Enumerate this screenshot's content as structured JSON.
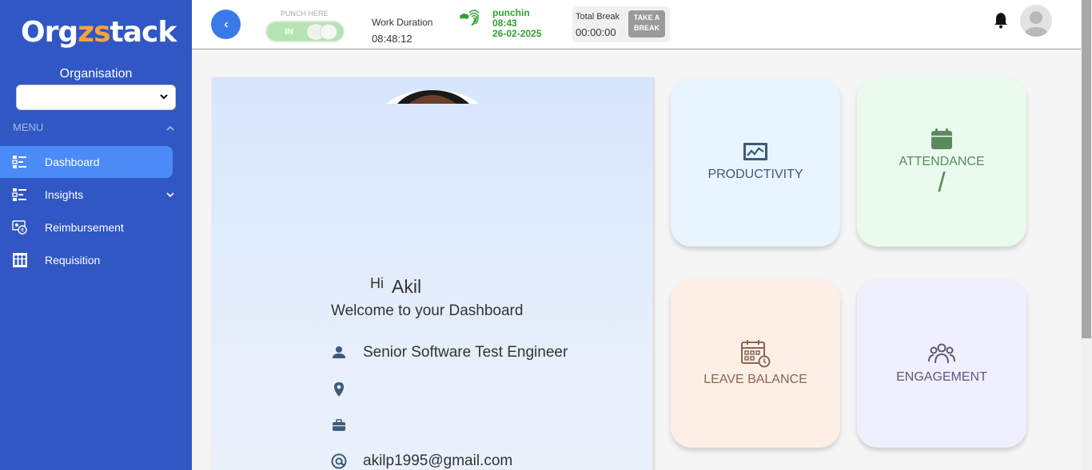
{
  "sidebar": {
    "logo_prefix": "Org",
    "logo_accent": "zs",
    "logo_suffix": "tack",
    "org_label": "Organisation",
    "org_selected": "",
    "menu_header": "MENU",
    "items": [
      {
        "label": "Dashboard",
        "icon": "dashboard-icon",
        "active": true
      },
      {
        "label": "Insights",
        "icon": "insights-icon",
        "active": false
      },
      {
        "label": "Reimbursement",
        "icon": "reimbursement-icon",
        "active": false
      },
      {
        "label": "Requisition",
        "icon": "requisition-icon",
        "active": false
      }
    ]
  },
  "topbar": {
    "back_icon": "chevron-left-icon",
    "punch_label": "PUNCH HERE",
    "punch_state": "IN",
    "work_duration_label": "Work Duration",
    "work_duration_value": "08:48:12",
    "punch_status": "punchin",
    "punch_time": "08:43",
    "punch_date": "26-02-2025",
    "total_break_label": "Total Break",
    "total_break_value": "00:00:00",
    "take_break_line1": "TAKE A",
    "take_break_line2": "BREAK"
  },
  "profile": {
    "greeting": "Hi",
    "name": "Akil",
    "welcome": "Welcome to your Dashboard",
    "designation": "Senior Software Test Engineer",
    "location": "",
    "department": "",
    "email": "akilp1995@gmail.com"
  },
  "tiles": {
    "productivity": "PRODUCTIVITY",
    "attendance": "ATTENDANCE",
    "attendance_value": "/",
    "leave_balance": "LEAVE BALANCE",
    "engagement": "ENGAGEMENT"
  },
  "colors": {
    "sidebar_bg": "#3057c4",
    "active_item": "#4a8bf8",
    "punch_green": "#2fa22f"
  }
}
